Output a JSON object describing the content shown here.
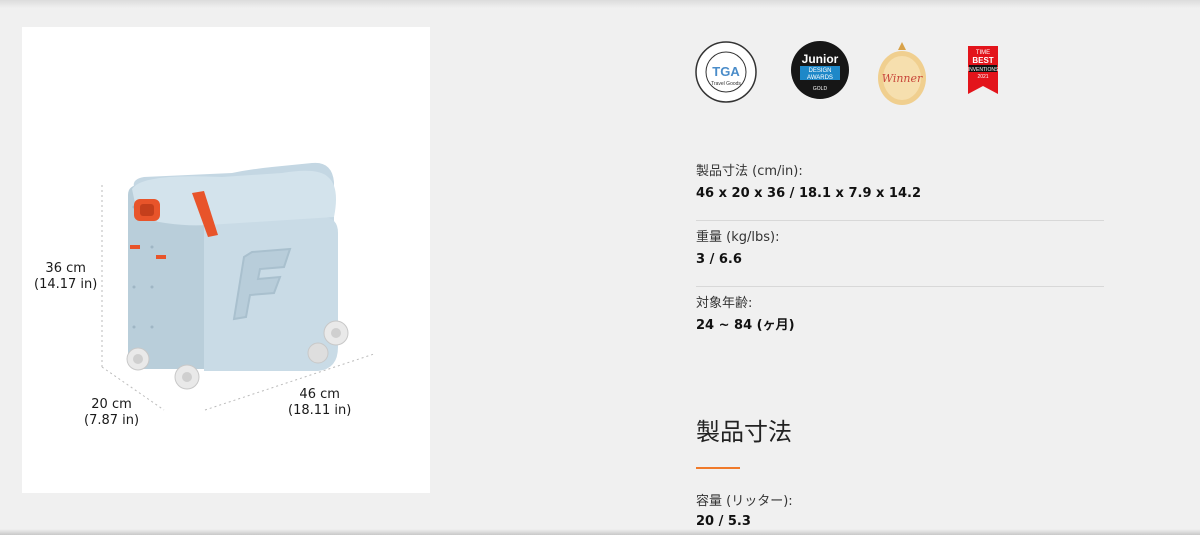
{
  "product_image": {
    "name": "BedBox ride-on suitcase",
    "dimensions": {
      "height": {
        "metric": "36 cm",
        "imperial": "(14.17 in)"
      },
      "depth": {
        "metric": "20 cm",
        "imperial": "(7.87 in)"
      },
      "width": {
        "metric": "46 cm",
        "imperial": "(18.11 in)"
      }
    },
    "colors": {
      "body": "#c9dbe6",
      "accent": "#e8542a"
    }
  },
  "awards": [
    {
      "icon": "product-innovation-award-badge",
      "text": "TGA",
      "subtext": "Travel Goods"
    },
    {
      "icon": "junior-design-awards-badge",
      "text": "Junior",
      "line2": "DESIGN",
      "line3": "AWARDS",
      "tier": "GOLD"
    },
    {
      "icon": "winner-medal-badge",
      "text": "Winner"
    },
    {
      "icon": "time-best-inventions-badge",
      "line1": "TIME",
      "line2": "BEST",
      "line3": "INVENTIONS",
      "year": "2021"
    }
  ],
  "specs": [
    {
      "label": "製品寸法 (cm/in):",
      "value": "46 x 20 x 36 / 18.1 x 7.9 x 14.2"
    },
    {
      "label": "重量 (kg/lbs):",
      "value": "3 / 6.6"
    },
    {
      "label": "対象年齢:",
      "value": "24 ~ 84 (ヶ月)"
    }
  ],
  "section": {
    "title": "製品寸法",
    "accent_color": "#f07a2a",
    "capacity_label": "容量 (リッター):",
    "capacity_value": "20 / 5.3"
  }
}
